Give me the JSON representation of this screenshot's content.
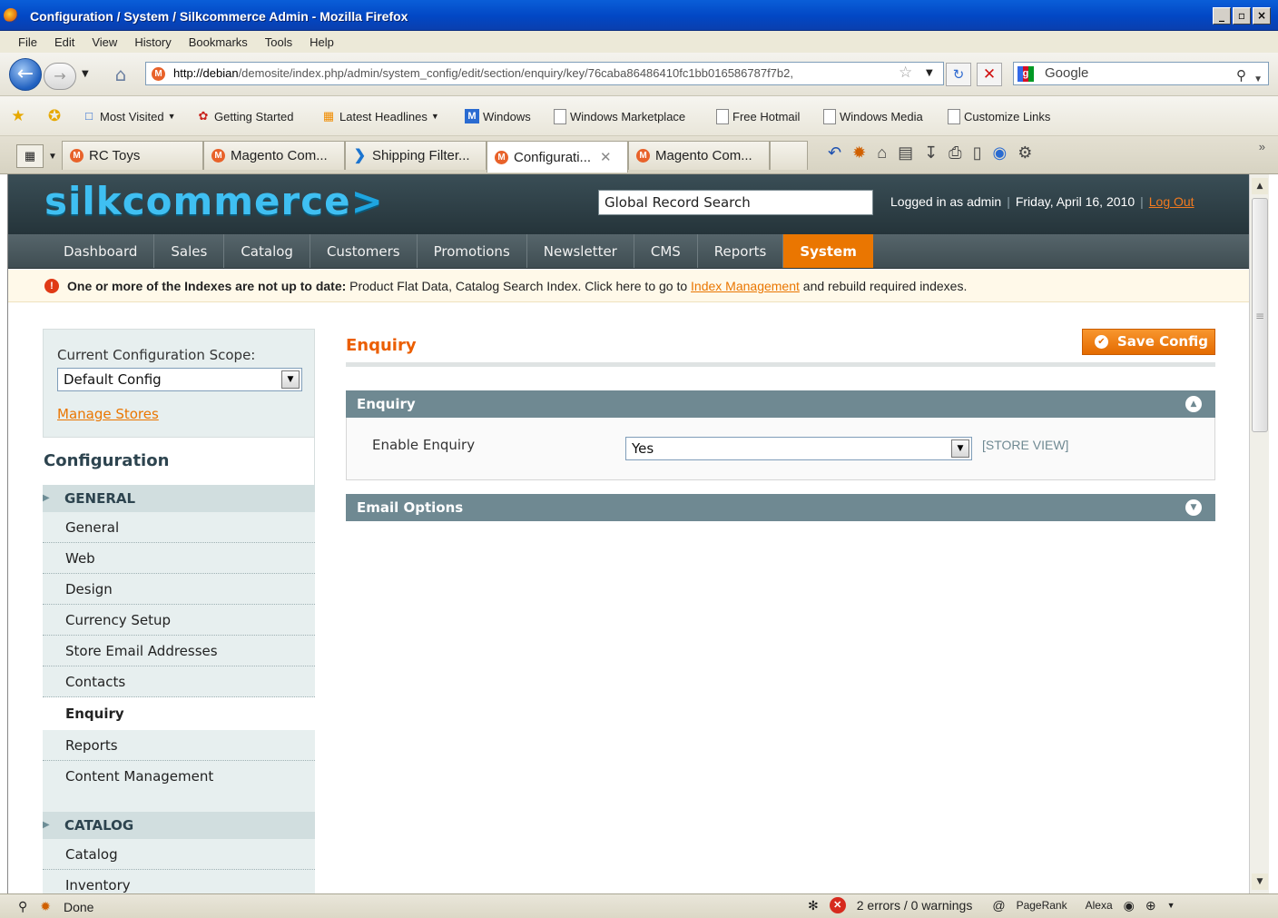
{
  "window": {
    "title": "Configuration / System / Silkcommerce Admin - Mozilla Firefox",
    "buttons": [
      "_",
      "▫",
      "×"
    ]
  },
  "menubar": [
    "File",
    "Edit",
    "View",
    "History",
    "Bookmarks",
    "Tools",
    "Help"
  ],
  "navigation": {
    "url_host": "http://debian",
    "url_path": "/demosite/index.php/admin/system_config/edit/section/enquiry/key/76caba86486410fc1bb016586787f7b2,",
    "search_engine": "Google"
  },
  "bookmarks": [
    "Most Visited",
    "Getting Started",
    "Latest Headlines",
    "Windows",
    "Windows Marketplace",
    "Free Hotmail",
    "Windows Media",
    "Customize Links"
  ],
  "tabs": [
    {
      "label": "RC Toys"
    },
    {
      "label": "Magento Com..."
    },
    {
      "label": "Shipping Filter..."
    },
    {
      "label": "Configurati..."
    },
    {
      "label": "Magento Com..."
    }
  ],
  "header": {
    "logo": "silkcommerce",
    "logo_arrow": ">",
    "search_placeholder": "Global Record Search",
    "logged_in": "Logged in as admin",
    "date": "Friday, April 16, 2010",
    "logout": "Log Out"
  },
  "nav": [
    "Dashboard",
    "Sales",
    "Catalog",
    "Customers",
    "Promotions",
    "Newsletter",
    "CMS",
    "Reports",
    "System"
  ],
  "nav_active": "System",
  "notice": {
    "bold": "One or more of the Indexes are not up to date:",
    "text": "Product Flat Data, Catalog Search Index. Click here to go to",
    "link": "Index Management",
    "suffix": "and rebuild required indexes."
  },
  "sidebar": {
    "scope_label": "Current Configuration Scope:",
    "scope_value": "Default Config",
    "manage_stores": "Manage Stores",
    "config_title": "Configuration",
    "general_heading": "GENERAL",
    "general_items": [
      "General",
      "Web",
      "Design",
      "Currency Setup",
      "Store Email Addresses",
      "Contacts",
      "Enquiry",
      "Reports",
      "Content Management"
    ],
    "catalog_heading": "CATALOG",
    "catalog_items": [
      "Catalog",
      "Inventory"
    ]
  },
  "main": {
    "title": "Enquiry",
    "save_button": "Save Config",
    "fieldsets": [
      {
        "title": "Enquiry",
        "expanded": true
      },
      {
        "title": "Email Options",
        "expanded": false
      }
    ],
    "field_label": "Enable Enquiry",
    "field_value": "Yes",
    "field_scope": "[STORE VIEW]"
  },
  "statusbar": {
    "status": "Done",
    "errors": "2 errors / 0 warnings",
    "pagerank": "PageRank",
    "alexa": "Alexa"
  },
  "colors": {
    "accent_orange": "#ea7601",
    "header_dark": "#2e3f45",
    "fieldset_head": "#6f8992",
    "sidebar_bg": "#e7efef"
  }
}
